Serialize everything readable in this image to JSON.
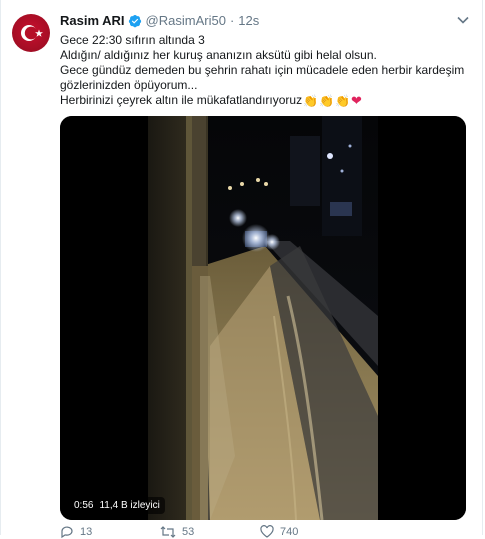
{
  "tweet": {
    "author_name": "Rasim ARI",
    "author_handle": "@RasimAri50",
    "separator": "·",
    "time": "12s",
    "lines": [
      "Gece 22:30  sıfırın altında 3",
      "Aldığın/ aldığınız her kuruş ananızın aksütü gibi helal olsun.",
      "Gece gündüz demeden bu şehrin rahatı için mücadele eden herbir kardeşim",
      "gözlerinizden öpüyorum...",
      "Herbirinizi çeyrek altın ile mükafatlandırıyoruz"
    ],
    "emojis": [
      "👏",
      "👏",
      "👏",
      "❤"
    ]
  },
  "video": {
    "duration": "0:56",
    "views": "11,4 B izleyici"
  },
  "actions": {
    "reply_count": "13",
    "retweet_count": "53",
    "like_count": "740"
  },
  "colors": {
    "verified": "#1da1f2",
    "heart": "#e0245e",
    "muted": "#657786",
    "avatar": "#c8102e"
  }
}
